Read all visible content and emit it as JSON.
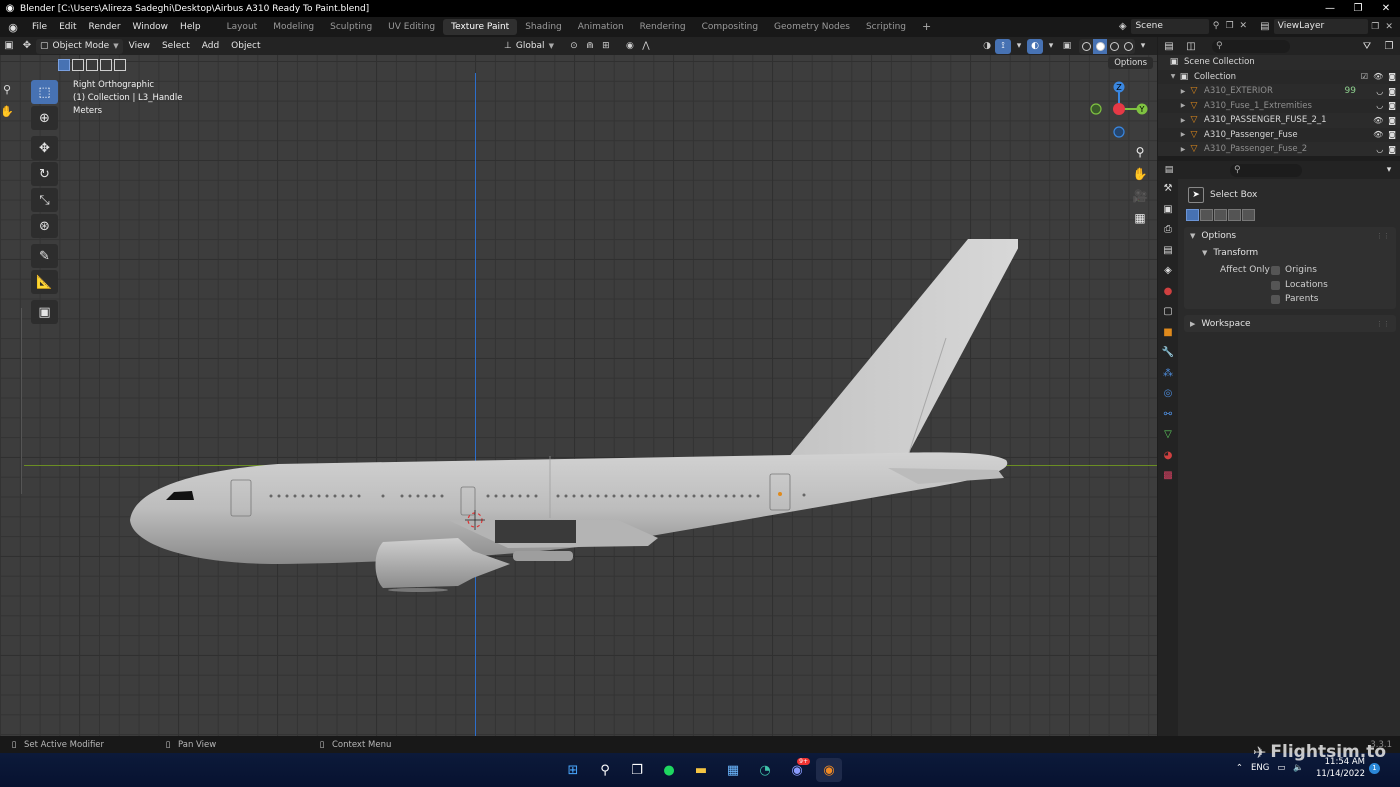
{
  "window": {
    "title": "Blender [C:\\Users\\Alireza Sadeghi\\Desktop\\Airbus A310 Ready To Paint.blend]",
    "controls": [
      "—",
      "❐",
      "✕"
    ]
  },
  "menu": [
    "File",
    "Edit",
    "Render",
    "Window",
    "Help"
  ],
  "workspaces": [
    "Layout",
    "Modeling",
    "Sculpting",
    "UV Editing",
    "Texture Paint",
    "Shading",
    "Animation",
    "Rendering",
    "Compositing",
    "Geometry Nodes",
    "Scripting"
  ],
  "active_workspace": "Texture Paint",
  "add_workspace": "+",
  "scene": {
    "name": "Scene",
    "view_layer": "ViewLayer"
  },
  "viewport_header": {
    "mode": "Object Mode",
    "menus": [
      "View",
      "Select",
      "Add",
      "Object"
    ],
    "transform_orientation": "Global"
  },
  "viewport": {
    "view_name": "Right Orthographic",
    "collection_info": "(1) Collection | L3_Handle",
    "units": "Meters",
    "options_label": "Options",
    "gizmo_labels": {
      "z": "Z",
      "y": "Y"
    }
  },
  "outliner": {
    "root": "Scene Collection",
    "collection": "Collection",
    "items": [
      {
        "label": "A310_EXTERIOR",
        "dim": true,
        "extra": "99"
      },
      {
        "label": "A310_Fuse_1_Extremities",
        "dim": true,
        "extra": ""
      },
      {
        "label": "A310_PASSENGER_FUSE_2_1",
        "dim": false,
        "extra": ""
      },
      {
        "label": "A310_Passenger_Fuse",
        "dim": false,
        "extra": ""
      },
      {
        "label": "A310_Passenger_Fuse_2",
        "dim": true,
        "extra": ""
      }
    ]
  },
  "properties": {
    "active_tool": "Select Box",
    "options_panel": "Options",
    "transform_panel": "Transform",
    "affect_only_label": "Affect Only",
    "affect_only": [
      "Origins",
      "Locations",
      "Parents"
    ],
    "workspace_panel": "Workspace"
  },
  "statusbar": {
    "hints": [
      "Set Active Modifier",
      "Pan View",
      "Context Menu"
    ],
    "version": "3.3.1"
  },
  "taskbar": {
    "language": "ENG",
    "time": "11:54 AM",
    "date": "11/14/2022",
    "discord_badge": "9+",
    "notification_count": "1"
  },
  "watermark": "Flightsim.to",
  "colors": {
    "accent": "#4772b3",
    "axis_y": "#6b8e23",
    "axis_z": "#2c6ecb",
    "gizmo_x": "#e63946",
    "gizmo_y": "#7fc241",
    "gizmo_z": "#3a87e0"
  }
}
